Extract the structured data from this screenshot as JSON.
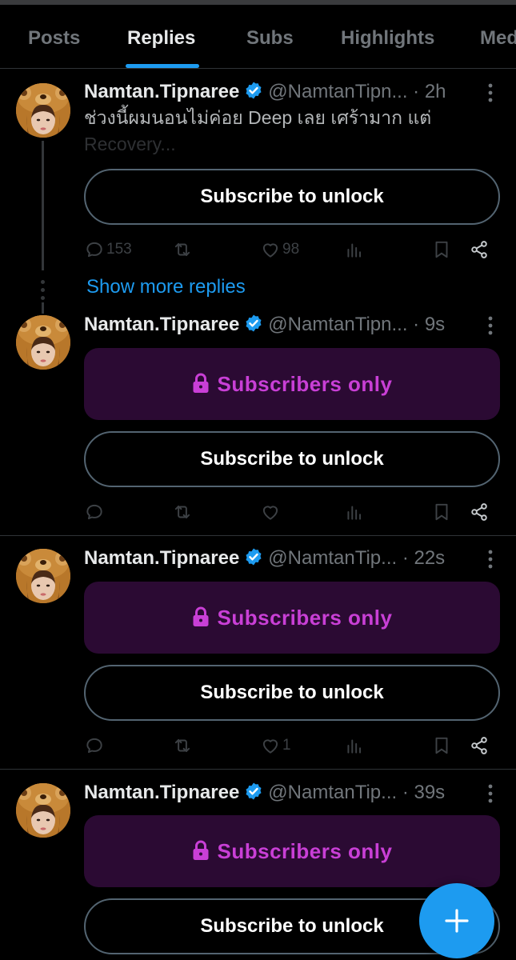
{
  "tabs": [
    {
      "label": "Posts"
    },
    {
      "label": "Replies"
    },
    {
      "label": "Subs"
    },
    {
      "label": "Highlights"
    },
    {
      "label": "Med"
    }
  ],
  "active_tab": "Replies",
  "posts": [
    {
      "name": "Namtan.Tipnaree",
      "handle": "@NamtanTipn...",
      "time": "· 2h",
      "text_line1": "ช่วงนี้ผมนอนไม่ค่อย Deep เลย เศร้ามาก แต่",
      "text_line2": "Recovery...",
      "subscribe_label": "Subscribe to unlock",
      "reply_count": "153",
      "like_count": "98"
    },
    {
      "name": "Namtan.Tipnaree",
      "handle": "@NamtanTipn...",
      "time": "· 9s",
      "locked_label": "Subscribers only",
      "subscribe_label": "Subscribe to unlock"
    },
    {
      "name": "Namtan.Tipnaree",
      "handle": "@NamtanTip...",
      "time": "· 22s",
      "locked_label": "Subscribers only",
      "subscribe_label": "Subscribe to unlock",
      "like_count": "1"
    },
    {
      "name": "Namtan.Tipnaree",
      "handle": "@NamtanTip...",
      "time": "· 39s",
      "locked_label": "Subscribers only",
      "subscribe_label": "Subscribe to unlock"
    }
  ],
  "show_more_label": "Show more replies",
  "icons": {
    "verified": "verified-badge-icon",
    "more": "more-vertical-icon",
    "reply": "reply-icon",
    "repost": "repost-icon",
    "like": "heart-icon",
    "views": "views-icon",
    "bookmark": "bookmark-icon",
    "share": "share-icon",
    "lock": "lock-icon",
    "compose": "plus-icon"
  },
  "colors": {
    "accent": "#1d9bf0",
    "locked_bg": "#2b0a33",
    "locked_text": "#c93fd6",
    "background": "#000000"
  }
}
